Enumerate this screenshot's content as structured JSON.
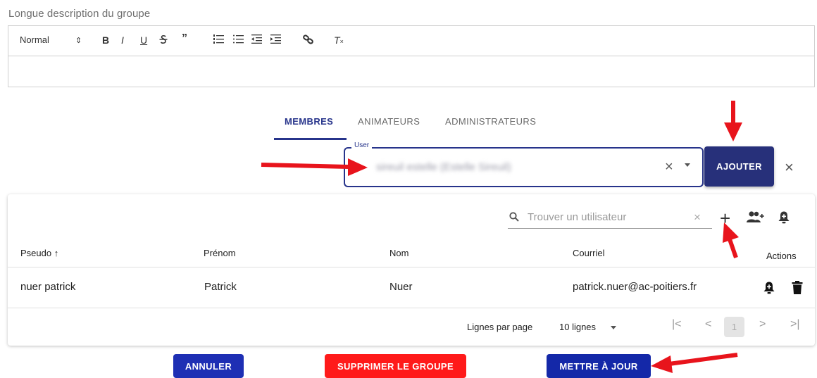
{
  "description": {
    "label": "Longue description du groupe",
    "toolbar": {
      "format_select": "Normal",
      "bold": "B",
      "italic": "I",
      "underline": "U",
      "quote": "”",
      "clear_format": "T"
    }
  },
  "tabs": [
    {
      "label": "MEMBRES",
      "active": true
    },
    {
      "label": "ANIMATEURS",
      "active": false
    },
    {
      "label": "ADMINISTRATEURS",
      "active": false
    }
  ],
  "user_field": {
    "label": "User",
    "value": "sireuil estelle (Estelle Sireuil)"
  },
  "add_button": "AJOUTER",
  "table": {
    "search_placeholder": "Trouver un utilisateur",
    "columns": [
      "Pseudo",
      "Prénom",
      "Nom",
      "Courriel",
      "Actions"
    ],
    "rows": [
      {
        "pseudo": "nuer patrick",
        "prenom": "Patrick",
        "nom": "Nuer",
        "courriel": "patrick.nuer@ac-poitiers.fr"
      }
    ],
    "pagination": {
      "rows_per_page_label": "Lignes par page",
      "rows_per_page_value": "10 lignes",
      "current_page": "1"
    }
  },
  "buttons": {
    "cancel": "ANNULER",
    "delete": "SUPPRIMER LE GROUPE",
    "update": "METTRE À JOUR"
  },
  "colors": {
    "primary": "#27348b",
    "danger": "#ff1a1a",
    "annotation_arrow": "#e8141c"
  },
  "icons": [
    "sort-arrow-up-icon",
    "search-icon",
    "plus-icon",
    "add-users-icon",
    "bell-icon",
    "trash-icon",
    "close-icon"
  ]
}
